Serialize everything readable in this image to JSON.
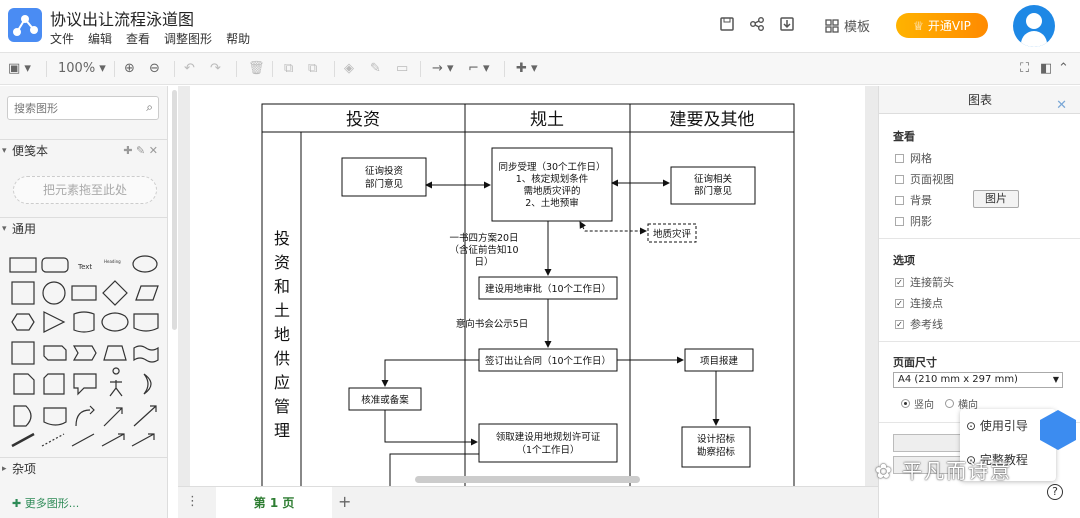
{
  "header": {
    "title": "协议出让流程泳道图",
    "menu": [
      "文件",
      "编辑",
      "查看",
      "调整图形",
      "帮助"
    ],
    "template_label": "模板",
    "vip_label": "开通VIP"
  },
  "toolbar": {
    "zoom": "100%"
  },
  "sidebar": {
    "search_placeholder": "搜索图形",
    "scratchpad_title": "便笺本",
    "drop_hint": "把元素拖至此处",
    "general_title": "通用",
    "misc_title": "杂项",
    "more_shapes": "更多图形...",
    "text_shape": "Text",
    "heading_shape": "Heading"
  },
  "diagram": {
    "lanes": [
      "投资",
      "规土",
      "建要及其他"
    ],
    "row_label": [
      "投",
      "资",
      "和",
      "土",
      "地",
      "供",
      "应",
      "管",
      "理"
    ],
    "boxes": {
      "consult_invest": [
        "征询投资",
        "部门意见"
      ],
      "sync_accept": [
        "同步受理（30个工作日）",
        "1、核定规划条件",
        "需地质灾评的",
        "2、土地预审"
      ],
      "consult_related": [
        "征询相关",
        "部门意见"
      ],
      "geo_hazard": "地质灾评",
      "land_approval": "建设用地审批（10个工作日）",
      "sign_contract": "签订出让合同（10个工作日）",
      "project_report": "项目报建",
      "approve_record": "核准或备案",
      "planning_permit": [
        "领取建设用地规划许可证",
        "（1个工作日）"
      ],
      "design_bid": [
        "设计招标",
        "勘察招标"
      ]
    },
    "notes": {
      "plan_notice": [
        "一书四方案20日",
        "（含征前告知10",
        "日）"
      ],
      "intent_notice": "意向书会公示5日"
    }
  },
  "bottom": {
    "page_tab": "第 1 页"
  },
  "rpanel": {
    "tab": "图表",
    "view_title": "查看",
    "view_items": [
      "网格",
      "页面视图",
      "背景",
      "阴影"
    ],
    "image_button": "图片",
    "options_title": "选项",
    "option_items": [
      "连接箭头",
      "连接点",
      "参考线"
    ],
    "page_size_title": "页面尺寸",
    "page_size_value": "A4 (210 mm x 297 mm)",
    "orient_portrait": "竖向",
    "orient_landscape": "横向",
    "guide": "使用引导",
    "tutorial": "完整教程",
    "watermark": "平凡而诗意",
    "help": "?"
  }
}
